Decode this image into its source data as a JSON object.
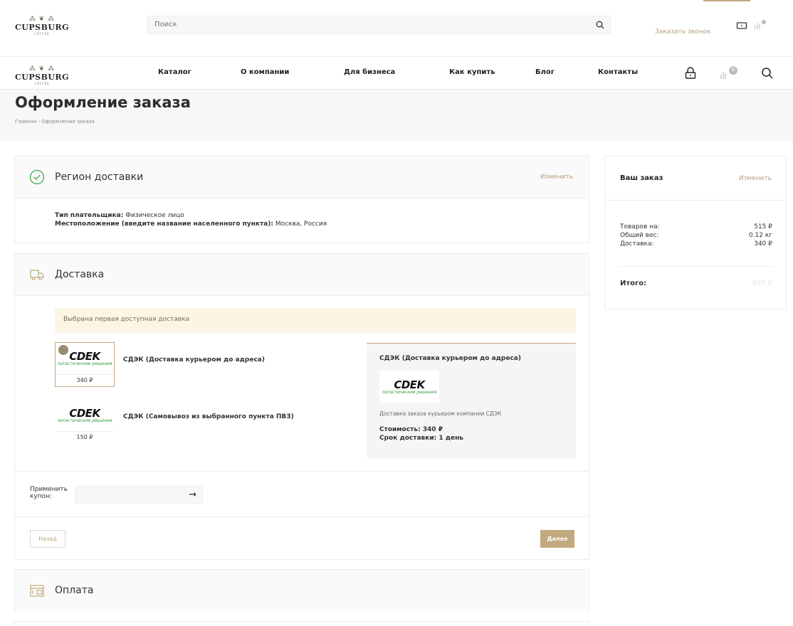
{
  "brand": {
    "name": "CUPSBURG",
    "sub": "COFFEE",
    "mark": "⁂ ❦ ⁂"
  },
  "header": {
    "search_placeholder": "Поиск",
    "callback": "Заказать звонок"
  },
  "nav": {
    "items": [
      {
        "label": "Каталог"
      },
      {
        "label": "О компании"
      },
      {
        "label": "Для бизнеса"
      },
      {
        "label": "Как купить"
      },
      {
        "label": "Блог"
      },
      {
        "label": "Контакты"
      }
    ],
    "compare_count": "0"
  },
  "page": {
    "title": "Оформление заказа",
    "breadcrumb": "Главная - Оформление заказа"
  },
  "region": {
    "title": "Регион доставки",
    "change": "Изменить",
    "payer_label": "Тип плательщика:",
    "payer_value": "Физическое лицо",
    "location_label": "Местоположение (введите название населенного пункта):",
    "location_value": "Москва, Россия"
  },
  "delivery": {
    "title": "Доставка",
    "notice": "Выбрана первая доступная доставка",
    "options": [
      {
        "name": "СДЭК (Доставка курьером до адреса)",
        "price": "340 ₽",
        "logo": "CDEK",
        "logo_sub": "логистические решения"
      },
      {
        "name": "СДЭК (Самовывоз из выбранного пункта ПВЗ)",
        "price": "150 ₽",
        "logo": "CDEK",
        "logo_sub": "логистические решения"
      }
    ],
    "detail": {
      "title": "СДЭК (Доставка курьером до адреса)",
      "desc": "Доставка заказа курьером компании СДЭК",
      "cost": "Стоимость: 340 ₽",
      "term": "Срок доставки: 1 день"
    },
    "coupon_label": "Применить купон:",
    "back": "Назад",
    "next": "Далее"
  },
  "payment": {
    "title": "Оплата"
  },
  "summary": {
    "title": "Ваш заказ",
    "change": "Изменить",
    "rows": [
      {
        "label": "Товаров на:",
        "value": "515 ₽"
      },
      {
        "label": "Общий вес:",
        "value": "0.12 кг"
      },
      {
        "label": "Доставка:",
        "value": "340 ₽"
      }
    ],
    "total_label": "Итого:",
    "total_value": "855 ₽"
  },
  "colors": {
    "accent": "#c2a97e",
    "notice_bg": "#fbf5e6",
    "cdek_green": "#2e9b3a"
  }
}
